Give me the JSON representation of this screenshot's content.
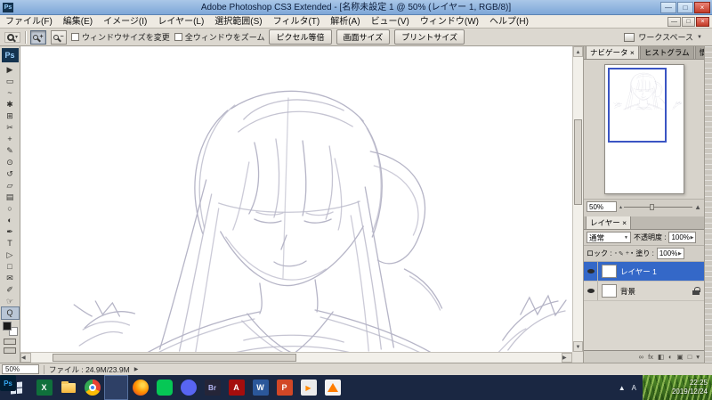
{
  "window": {
    "title": "Adobe Photoshop CS3 Extended - [名称未設定 1 @ 50% (レイヤー 1, RGB/8)]",
    "app_icon": "Ps",
    "minimize": "—",
    "maximize": "□",
    "close": "×"
  },
  "menu": {
    "items": [
      "ファイル(F)",
      "編集(E)",
      "イメージ(I)",
      "レイヤー(L)",
      "選択範囲(S)",
      "フィルタ(T)",
      "解析(A)",
      "ビュー(V)",
      "ウィンドウ(W)",
      "ヘルプ(H)"
    ],
    "doc_minimize": "—",
    "doc_restore": "□",
    "doc_close": "×"
  },
  "options": {
    "tool_dropdown_arrow": "▾",
    "zoom_in_glyph": "+",
    "zoom_out_glyph": "−",
    "resize_windows_label": "ウィンドウサイズを変更",
    "zoom_all_label": "全ウィンドウをズーム",
    "actual_pixels_button": "ピクセル等倍",
    "fit_screen_button": "画面サイズ",
    "print_size_button": "プリントサイズ",
    "workspace_button": "ワークスペース",
    "workspace_arrow": "▼"
  },
  "toolbar": {
    "logo": "Ps",
    "tools": [
      {
        "name": "move",
        "g": "▶"
      },
      {
        "name": "rectangular-marquee",
        "g": "▭"
      },
      {
        "name": "lasso",
        "g": "~"
      },
      {
        "name": "quick-selection",
        "g": "✱"
      },
      {
        "name": "crop",
        "g": "⊞"
      },
      {
        "name": "slice",
        "g": "✂"
      },
      {
        "name": "healing-brush",
        "g": "+"
      },
      {
        "name": "brush",
        "g": "✎"
      },
      {
        "name": "clone-stamp",
        "g": "⊙"
      },
      {
        "name": "history-brush",
        "g": "↺"
      },
      {
        "name": "eraser",
        "g": "▱"
      },
      {
        "name": "gradient",
        "g": "▤"
      },
      {
        "name": "blur",
        "g": "○"
      },
      {
        "name": "dodge",
        "g": "◐"
      },
      {
        "name": "pen",
        "g": "✒"
      },
      {
        "name": "type",
        "g": "T"
      },
      {
        "name": "path-selection",
        "g": "▷"
      },
      {
        "name": "shape",
        "g": "□"
      },
      {
        "name": "notes",
        "g": "✉"
      },
      {
        "name": "eyedropper",
        "g": "✐"
      },
      {
        "name": "hand",
        "g": "☞"
      },
      {
        "name": "zoom",
        "g": "Q"
      }
    ]
  },
  "navigator": {
    "tab_active": "ナビゲータ ×",
    "tab2": "ヒストグラム",
    "tab3": "情報",
    "zoom_value": "50%",
    "slider_small": "▴",
    "slider_large": "▲"
  },
  "layers": {
    "tab": "レイヤー ×",
    "blend_mode": "通常",
    "blend_arrow": "▼",
    "opacity_label": "不透明度 :",
    "opacity_value": "100%",
    "lock_label": "ロック :",
    "lock_icons": [
      "▫",
      "✎",
      "+",
      "▪"
    ],
    "fill_label": "塗り :",
    "fill_value": "100%",
    "spin_arrow": "▶",
    "rows": [
      {
        "name": "レイヤー 1"
      },
      {
        "name": "背景"
      }
    ],
    "bottom_icons": [
      "∞",
      "fx",
      "◧",
      "◐",
      "▣",
      "□",
      "▾"
    ]
  },
  "scroll": {
    "up": "▲",
    "down": "▼",
    "left": "◀",
    "right": "▶"
  },
  "status": {
    "zoom": "50%",
    "file_info": "ファイル : 24.9M/23.9M",
    "expand_arrow": "▶"
  },
  "taskbar": {
    "apps": [
      {
        "name": "excel",
        "g": "X"
      },
      {
        "name": "file-explorer",
        "g": ""
      },
      {
        "name": "chrome",
        "g": ""
      },
      {
        "name": "photoshop",
        "g": "Ps"
      },
      {
        "name": "firefox",
        "g": ""
      },
      {
        "name": "line",
        "g": ""
      },
      {
        "name": "discord",
        "g": ""
      },
      {
        "name": "bridge",
        "g": "Br"
      },
      {
        "name": "acrobat",
        "g": "A"
      },
      {
        "name": "word",
        "g": "W"
      },
      {
        "name": "powerpoint",
        "g": "P"
      },
      {
        "name": "media-player",
        "g": "▶"
      },
      {
        "name": "vlc",
        "g": ""
      }
    ],
    "tray": [
      "▲",
      "A"
    ],
    "time": "22:25",
    "date": "2019/12/24"
  }
}
